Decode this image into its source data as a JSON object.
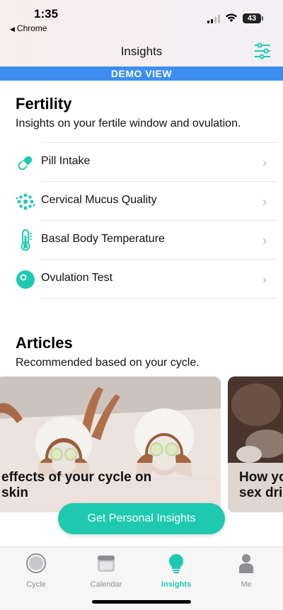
{
  "status": {
    "time": "1:35",
    "back_app": "Chrome",
    "battery": "43"
  },
  "header": {
    "title": "Insights"
  },
  "banner": {
    "text": "DEMO VIEW"
  },
  "fertility": {
    "title": "Fertility",
    "subtitle": "Insights on your fertile window and ovulation.",
    "items": [
      {
        "label": "Pill Intake",
        "icon": "pill-icon"
      },
      {
        "label": "Cervical Mucus Quality",
        "icon": "mucus-dots-icon"
      },
      {
        "label": "Basal Body Temperature",
        "icon": "thermometer-icon"
      },
      {
        "label": "Ovulation Test",
        "icon": "ovulation-test-icon"
      }
    ]
  },
  "articles": {
    "title": "Articles",
    "subtitle": "Recommended based on your cycle.",
    "cards": [
      {
        "caption_line1": "effects of your cycle on",
        "caption_line2": "skin"
      },
      {
        "caption_line1": "How yo",
        "caption_line2": "sex dri"
      }
    ]
  },
  "cta": {
    "label": "Get Personal Insights"
  },
  "tabs": [
    {
      "label": "Cycle",
      "icon": "cycle-icon",
      "active": false
    },
    {
      "label": "Calendar",
      "icon": "calendar-icon",
      "active": false
    },
    {
      "label": "Insights",
      "icon": "lightbulb-icon",
      "active": true
    },
    {
      "label": "Me",
      "icon": "person-icon",
      "active": false
    }
  ],
  "colors": {
    "accent": "#1ec9b0",
    "banner": "#3d8ef0"
  }
}
